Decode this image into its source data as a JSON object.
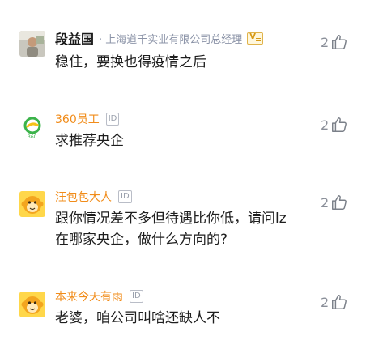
{
  "comments": [
    {
      "user": "段益国",
      "title": "· 上海道千实业有限公司总经理",
      "badge": "V",
      "text_lines": [
        "稳住，要换也得疫情之后"
      ],
      "likes": "2",
      "avatar_icon": "photo-avatar"
    },
    {
      "user": "360员工",
      "badge": "ID",
      "text_lines": [
        "求推荐央企"
      ],
      "likes": "2",
      "avatar_icon": "360-logo-avatar",
      "avatar_caption": "360"
    },
    {
      "user": "汪包包大人",
      "badge": "ID",
      "text_lines": [
        "跟你情况差不多但待遇比你低，请问lz",
        "在哪家央企，做什么方向的?"
      ],
      "likes": "2",
      "avatar_icon": "monkey-avatar"
    },
    {
      "user": "本来今天有雨",
      "badge": "ID",
      "text_lines": [
        "老婆，咱公司叫啥还缺人不"
      ],
      "likes": "2",
      "avatar_icon": "monkey-avatar"
    }
  ],
  "colors": {
    "orange_name": "#f18c1a",
    "blue_name": "#5a8fd6",
    "like_gray": "#8a8f99"
  }
}
